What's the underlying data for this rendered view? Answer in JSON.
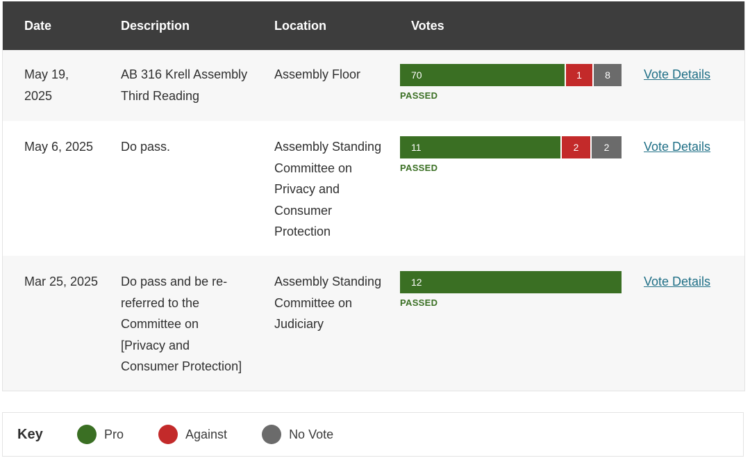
{
  "table": {
    "headers": {
      "date": "Date",
      "description": "Description",
      "location": "Location",
      "votes": "Votes"
    },
    "rows": [
      {
        "date": "May 19, 2025",
        "description": [
          "AB 316 Krell Assembly",
          "Third Reading"
        ],
        "location": [
          "Assembly Floor"
        ],
        "votes": {
          "pro": 70,
          "against": 1,
          "no_vote": 8
        },
        "status": "PASSED",
        "link": "Vote Details"
      },
      {
        "date": "May 6, 2025",
        "description": [
          "Do pass."
        ],
        "location": [
          "Assembly Standing",
          "Committee on",
          "Privacy and",
          "Consumer",
          "Protection"
        ],
        "votes": {
          "pro": 11,
          "against": 2,
          "no_vote": 2
        },
        "status": "PASSED",
        "link": "Vote Details"
      },
      {
        "date": "Mar 25, 2025",
        "description": [
          "Do pass and be re-",
          "referred to the",
          "Committee on",
          "[Privacy and",
          "Consumer Protection]"
        ],
        "location": [
          "Assembly Standing",
          "Committee on",
          "Judiciary"
        ],
        "votes": {
          "pro": 12,
          "against": 0,
          "no_vote": 0
        },
        "status": "PASSED",
        "link": "Vote Details"
      }
    ]
  },
  "key": {
    "title": "Key",
    "items": [
      {
        "label": "Pro",
        "color": "#3a6f23"
      },
      {
        "label": "Against",
        "color": "#c32a2a"
      },
      {
        "label": "No Vote",
        "color": "#6b6b6b"
      }
    ]
  }
}
